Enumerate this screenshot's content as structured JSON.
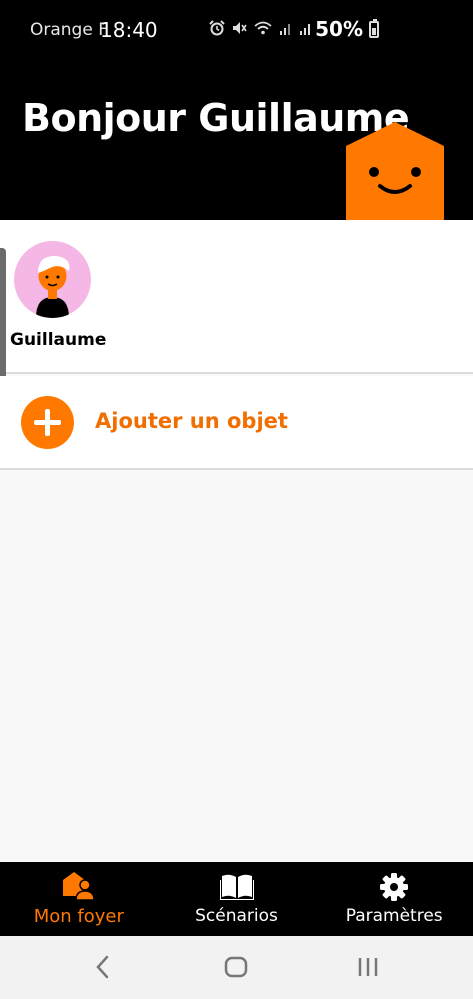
{
  "status_bar": {
    "carrier": "Orange F",
    "time": "18:40",
    "battery_percent": "50%",
    "icons": [
      "alarm-icon",
      "mute-icon",
      "wifi-icon",
      "signal-icon",
      "signal-icon",
      "battery-icon"
    ]
  },
  "header": {
    "greeting": "Bonjour Guillaume",
    "mascot": "house-mascot"
  },
  "members": [
    {
      "name": "Guillaume",
      "avatar": "avatar-icon"
    }
  ],
  "add_object": {
    "label": "Ajouter un objet",
    "icon": "plus-icon"
  },
  "bottom_nav": {
    "items": [
      {
        "label": "Mon foyer",
        "icon": "home-people-icon",
        "active": true
      },
      {
        "label": "Scénarios",
        "icon": "book-icon",
        "active": false
      },
      {
        "label": "Paramètres",
        "icon": "gear-icon",
        "active": false
      }
    ]
  },
  "colors": {
    "accent": "#ff7900",
    "header_bg": "#000000",
    "avatar_bg": "#f5b8e6"
  }
}
